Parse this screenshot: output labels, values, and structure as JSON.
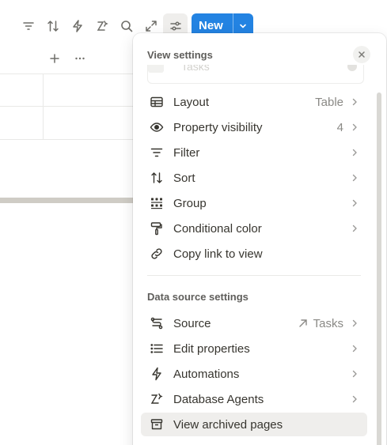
{
  "toolbar": {
    "icons": [
      "filter-icon",
      "sort-icon",
      "automation-icon",
      "agent-icon",
      "search-icon",
      "expand-icon",
      "settings-sliders-icon"
    ],
    "new_label": "New"
  },
  "table": {
    "column_actions": [
      "plus-icon",
      "more-icon"
    ]
  },
  "panel": {
    "view_settings_title": "View settings",
    "ghost_input_value": "Tasks",
    "view_items": [
      {
        "label": "Layout",
        "value": "Table",
        "icon": "table-icon"
      },
      {
        "label": "Property visibility",
        "value": "4",
        "icon": "eye-icon"
      },
      {
        "label": "Filter",
        "icon": "filter-icon"
      },
      {
        "label": "Sort",
        "icon": "sort-icon"
      },
      {
        "label": "Group",
        "icon": "group-icon"
      },
      {
        "label": "Conditional color",
        "icon": "paint-roller-icon"
      },
      {
        "label": "Copy link to view",
        "icon": "link-icon"
      }
    ],
    "data_source_title": "Data source settings",
    "source_items": [
      {
        "label": "Source",
        "value": "Tasks",
        "icon": "source-icon"
      },
      {
        "label": "Edit properties",
        "icon": "list-icon"
      },
      {
        "label": "Automations",
        "icon": "automation-icon"
      },
      {
        "label": "Database Agents",
        "icon": "agent-icon"
      },
      {
        "label": "View archived pages",
        "icon": "archive-icon"
      }
    ]
  },
  "colors": {
    "accent": "#2383e2",
    "text": "#37352f",
    "muted": "#8a8985",
    "hover": "#efeeec"
  }
}
